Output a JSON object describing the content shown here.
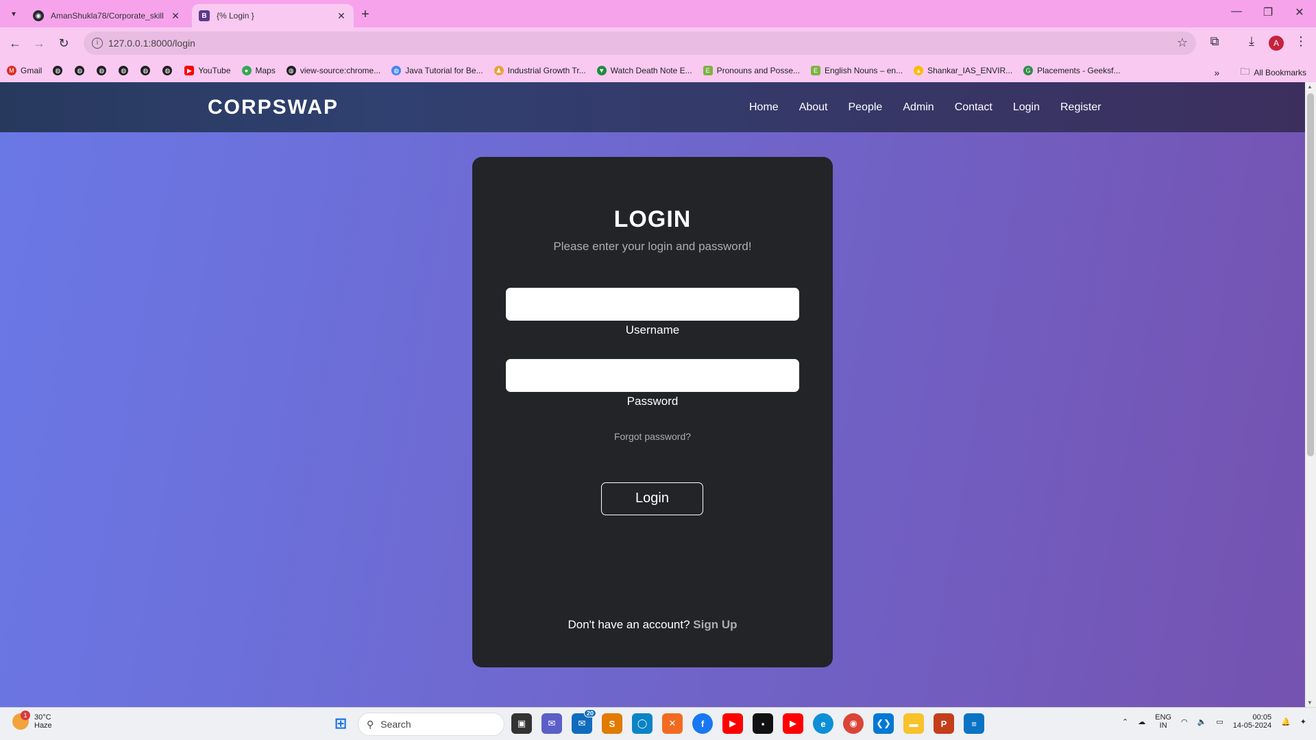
{
  "browser": {
    "tabs": [
      {
        "title": "AmanShukla78/Corporate_skill",
        "icon": "github-icon"
      },
      {
        "title": "{% Login }",
        "icon": "bootstrap-icon"
      }
    ],
    "url": "127.0.0.1:8000/login",
    "profile_initial": "A",
    "bookmarks": [
      {
        "label": "Gmail",
        "color": "#d93025"
      },
      {
        "label": "",
        "color": "#222222"
      },
      {
        "label": "",
        "color": "#222222"
      },
      {
        "label": "",
        "color": "#222222"
      },
      {
        "label": "",
        "color": "#222222"
      },
      {
        "label": "",
        "color": "#222222"
      },
      {
        "label": "",
        "color": "#222222"
      },
      {
        "label": "YouTube",
        "color": "#ff0000"
      },
      {
        "label": "Maps",
        "color": "#34a853"
      },
      {
        "label": "view-source:chrome...",
        "color": "#222222"
      },
      {
        "label": "Java Tutorial for Be...",
        "color": "#4285f4"
      },
      {
        "label": "Industrial Growth Tr...",
        "color": "#e8a33c"
      },
      {
        "label": "Watch Death Note E...",
        "color": "#1e8e3e"
      },
      {
        "label": "Pronouns and Posse...",
        "color": "#7cb342"
      },
      {
        "label": "English Nouns – en...",
        "color": "#7cb342"
      },
      {
        "label": "Shankar_IAS_ENVIR...",
        "color": "#fbbc04"
      },
      {
        "label": "Placements - Geeksf...",
        "color": "#2f8d46"
      }
    ],
    "all_bookmarks": "All Bookmarks"
  },
  "site": {
    "brand": "CORPSWAP",
    "nav": [
      "Home",
      "About",
      "People",
      "Admin",
      "Contact",
      "Login",
      "Register"
    ]
  },
  "login": {
    "title": "LOGIN",
    "subtitle": "Please enter your login and password!",
    "username_label": "Username",
    "password_label": "Password",
    "forgot": "Forgot password?",
    "button": "Login",
    "signup_prompt": "Don't have an account?",
    "signup_link": "Sign Up"
  },
  "taskbar": {
    "weather_temp": "30°C",
    "weather_desc": "Haze",
    "weather_badge": "1",
    "search_placeholder": "Search",
    "mail_badge": "20",
    "lang_line1": "ENG",
    "lang_line2": "IN",
    "time": "00:05",
    "date": "14-05-2024"
  }
}
